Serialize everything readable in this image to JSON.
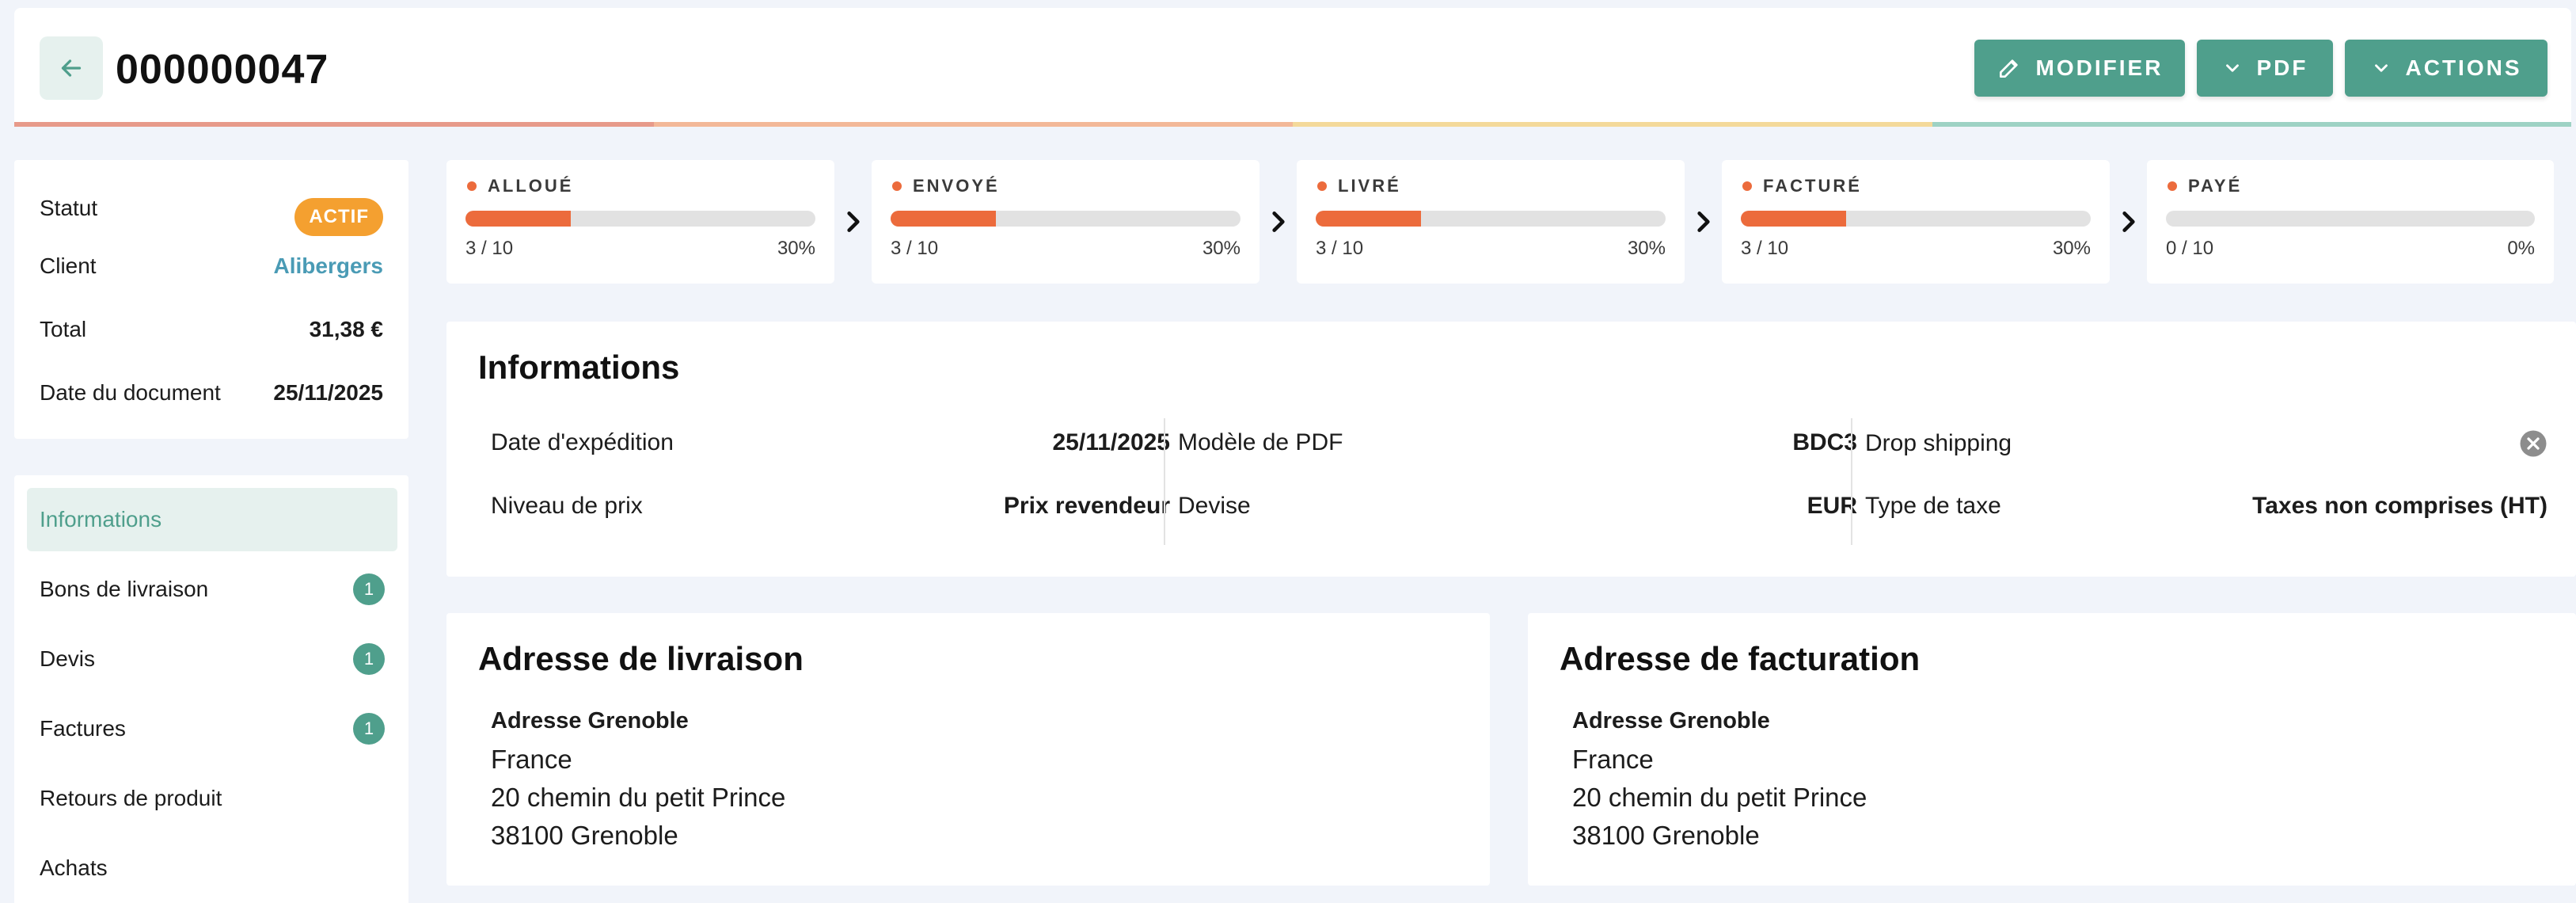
{
  "header": {
    "title": "000000047",
    "buttons": {
      "edit": "MODIFIER",
      "pdf": "PDF",
      "actions": "ACTIONS"
    },
    "strip_colors": [
      "#e79a8a",
      "#f3b898",
      "#f4d99a",
      "#9ed2c4"
    ]
  },
  "summary": {
    "status_label": "Statut",
    "status_value": "ACTIF",
    "client_label": "Client",
    "client_value": "Alibergers",
    "total_label": "Total",
    "total_value": "31,38 €",
    "date_label": "Date du document",
    "date_value": "25/11/2025"
  },
  "nav": {
    "items": [
      {
        "label": "Informations",
        "count": ""
      },
      {
        "label": "Bons de livraison",
        "count": "1"
      },
      {
        "label": "Devis",
        "count": "1"
      },
      {
        "label": "Factures",
        "count": "1"
      },
      {
        "label": "Retours de produit",
        "count": ""
      },
      {
        "label": "Achats",
        "count": ""
      }
    ]
  },
  "steps": [
    {
      "label": "ALLOUÉ",
      "count": "3 / 10",
      "pct": "30%",
      "fraction": 0.3
    },
    {
      "label": "ENVOYÉ",
      "count": "3 / 10",
      "pct": "30%",
      "fraction": 0.3
    },
    {
      "label": "LIVRÉ",
      "count": "3 / 10",
      "pct": "30%",
      "fraction": 0.3
    },
    {
      "label": "FACTURÉ",
      "count": "3 / 10",
      "pct": "30%",
      "fraction": 0.3
    },
    {
      "label": "PAYÉ",
      "count": "0 / 10",
      "pct": "0%",
      "fraction": 0
    }
  ],
  "informations": {
    "title": "Informations",
    "ship_date_label": "Date d'expédition",
    "ship_date_value": "25/11/2025",
    "pdf_model_label": "Modèle de PDF",
    "pdf_model_value": "BDC3",
    "drop_label": "Drop shipping",
    "price_level_label": "Niveau de prix",
    "price_level_value": "Prix revendeur",
    "currency_label": "Devise",
    "currency_value": "EUR",
    "tax_label": "Type de taxe",
    "tax_value": "Taxes non comprises (HT)"
  },
  "delivery": {
    "title": "Adresse de livraison",
    "name": "Adresse Grenoble",
    "country": "France",
    "street": "20 chemin du petit Prince",
    "city": "38100 Grenoble"
  },
  "billing": {
    "title": "Adresse de facturation",
    "name": "Adresse Grenoble",
    "country": "France",
    "street": "20 chemin du petit Prince",
    "city": "38100 Grenoble"
  }
}
